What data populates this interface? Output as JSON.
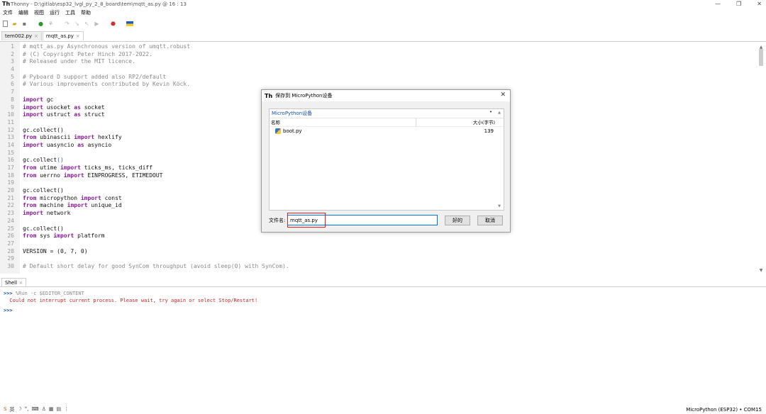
{
  "window": {
    "title": "Thonny  -  D:\\gitlab\\esp32_lvgl_py_2_8_board\\tem\\mqtt_as.py  @  16 : 13",
    "min": "—",
    "max": "❐",
    "close": "✕"
  },
  "menu": [
    "文件",
    "编辑",
    "视图",
    "运行",
    "工具",
    "帮助"
  ],
  "tabs": [
    {
      "label": "tem002.py",
      "close": "×"
    },
    {
      "label": "mqtt_as.py",
      "close": "×"
    }
  ],
  "code_lines": [
    [
      {
        "t": "# mqtt_as.py Asynchronous version of umqtt.robust",
        "c": "cm"
      }
    ],
    [
      {
        "t": "# (C) Copyright Peter Hinch 2017-2022.",
        "c": "cm"
      }
    ],
    [
      {
        "t": "# Released under the MIT licence.",
        "c": "cm"
      }
    ],
    [],
    [
      {
        "t": "# Pyboard D support added also RP2/default",
        "c": "cm"
      }
    ],
    [
      {
        "t": "# Various improvements contributed by Kevin Köck.",
        "c": "cm"
      }
    ],
    [],
    [
      {
        "t": "import",
        "c": "kw"
      },
      {
        "t": " gc",
        "c": "nb"
      }
    ],
    [
      {
        "t": "import",
        "c": "kw"
      },
      {
        "t": " usocket ",
        "c": "nb"
      },
      {
        "t": "as",
        "c": "kw"
      },
      {
        "t": " socket",
        "c": "nb"
      }
    ],
    [
      {
        "t": "import",
        "c": "kw"
      },
      {
        "t": " ustruct ",
        "c": "nb"
      },
      {
        "t": "as",
        "c": "kw"
      },
      {
        "t": " struct",
        "c": "nb"
      }
    ],
    [],
    [
      {
        "t": "gc.collect()",
        "c": "nb"
      }
    ],
    [
      {
        "t": "from",
        "c": "kw"
      },
      {
        "t": " ubinascii ",
        "c": "nb"
      },
      {
        "t": "import",
        "c": "kw"
      },
      {
        "t": " hexlify",
        "c": "nb"
      }
    ],
    [
      {
        "t": "import",
        "c": "kw"
      },
      {
        "t": " uasyncio ",
        "c": "nb"
      },
      {
        "t": "as",
        "c": "kw"
      },
      {
        "t": " asyncio",
        "c": "nb"
      }
    ],
    [],
    [
      {
        "t": "gc.collect",
        "c": "nb"
      },
      {
        "t": "()",
        "c": "br"
      }
    ],
    [
      {
        "t": "from",
        "c": "kw"
      },
      {
        "t": " utime ",
        "c": "nb"
      },
      {
        "t": "import",
        "c": "kw"
      },
      {
        "t": " ticks_ms, ticks_diff",
        "c": "nb"
      }
    ],
    [
      {
        "t": "from",
        "c": "kw"
      },
      {
        "t": " uerrno ",
        "c": "nb"
      },
      {
        "t": "import",
        "c": "kw"
      },
      {
        "t": " EINPROGRESS, ETIMEDOUT",
        "c": "nb"
      }
    ],
    [],
    [
      {
        "t": "gc.collect()",
        "c": "nb"
      }
    ],
    [
      {
        "t": "from",
        "c": "kw"
      },
      {
        "t": " micropython ",
        "c": "nb"
      },
      {
        "t": "import",
        "c": "kw"
      },
      {
        "t": " const",
        "c": "nb"
      }
    ],
    [
      {
        "t": "from",
        "c": "kw"
      },
      {
        "t": " machine ",
        "c": "nb"
      },
      {
        "t": "import",
        "c": "kw"
      },
      {
        "t": " unique_id",
        "c": "nb"
      }
    ],
    [
      {
        "t": "import",
        "c": "kw"
      },
      {
        "t": " network",
        "c": "nb"
      }
    ],
    [],
    [
      {
        "t": "gc.collect()",
        "c": "nb"
      }
    ],
    [
      {
        "t": "from",
        "c": "kw"
      },
      {
        "t": " sys ",
        "c": "nb"
      },
      {
        "t": "import",
        "c": "kw"
      },
      {
        "t": " platform",
        "c": "nb"
      }
    ],
    [],
    [
      {
        "t": "VERSION = (0, 7, 0)",
        "c": "nb"
      }
    ],
    [],
    [
      {
        "t": "# Default short delay for good SynCom throughput (avoid sleep(0) with SynCom).",
        "c": "cm"
      }
    ]
  ],
  "shell": {
    "tab_label": "Shell",
    "tab_close": "×",
    "prompt": ">>>",
    "command": " %Run -c $EDITOR_CONTENT",
    "error": "  Could not interrupt current process. Please wait, try again or select Stop/Restart!",
    "prompt2": ">>>"
  },
  "statusbar": {
    "right": "MicroPython (ESP32)  •  COM15"
  },
  "dialog": {
    "title": "保存到 MicroPython设备",
    "location": "MicroPython设备",
    "col_name": "名称",
    "col_size": "大小(字节)",
    "files": [
      {
        "name": "boot.py",
        "size": "139"
      }
    ],
    "filename_label": "文件名:",
    "filename_value": "mqtt_as.py",
    "ok_label": "好的",
    "cancel_label": "取消",
    "close": "✕"
  }
}
